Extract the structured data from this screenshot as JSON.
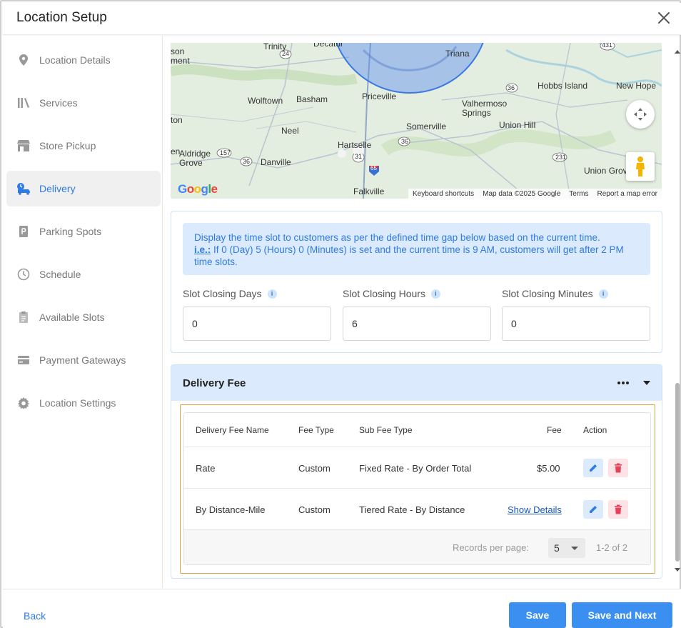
{
  "window": {
    "title": "Location Setup"
  },
  "sidebar": {
    "items": [
      {
        "label": "Location Details",
        "icon": "map-pin-icon"
      },
      {
        "label": "Services",
        "icon": "services-icon"
      },
      {
        "label": "Store Pickup",
        "icon": "store-icon"
      },
      {
        "label": "Delivery",
        "icon": "delivery-truck-icon",
        "active": true
      },
      {
        "label": "Parking Spots",
        "icon": "parking-icon"
      },
      {
        "label": "Schedule",
        "icon": "clock-icon"
      },
      {
        "label": "Available Slots",
        "icon": "clipboard-icon"
      },
      {
        "label": "Payment Gateways",
        "icon": "card-icon"
      },
      {
        "label": "Location Settings",
        "icon": "gear-icon"
      }
    ]
  },
  "map": {
    "places": [
      "Trinity",
      "Decatur",
      "Triana",
      "Hobbs Island",
      "New Hope",
      "Wolftown",
      "Basham",
      "Priceville",
      "Valhermoso Springs",
      "Somerville",
      "Union Hill",
      "Neel",
      "Hartselle",
      "Aldridge Grove",
      "Danville",
      "Union Grove",
      "Falkville",
      "son ment",
      "ton",
      "en"
    ],
    "roads": [
      "24",
      "431",
      "36",
      "157",
      "36",
      "31",
      "36",
      "231",
      "65"
    ],
    "footer": {
      "shortcuts": "Keyboard shortcuts",
      "data": "Map data ©2025 Google",
      "terms": "Terms",
      "report": "Report a map error"
    },
    "logo": "Google"
  },
  "slots": {
    "info_line1": "Display the time slot to customers as per the defined time gap below based on the current time.",
    "info_ie": "i.e.:",
    "info_line2": " If 0 (Day) 5 (Hours) 0 (Minutes) is set and the current time is 9 AM, customers will get after 2 PM time slots.",
    "days_label": "Slot Closing Days",
    "hours_label": "Slot Closing Hours",
    "minutes_label": "Slot Closing Minutes",
    "days_value": "0",
    "hours_value": "6",
    "minutes_value": "0",
    "info_glyph": "i"
  },
  "delivery_fee": {
    "title": "Delivery Fee",
    "columns": {
      "name": "Delivery Fee Name",
      "fee_type": "Fee Type",
      "sub_fee_type": "Sub Fee Type",
      "fee": "Fee",
      "action": "Action"
    },
    "rows": [
      {
        "name": "Rate",
        "fee_type": "Custom",
        "sub_fee_type": "Fixed Rate - By Order Total",
        "fee": "$5.00"
      },
      {
        "name": "By Distance-Mile",
        "fee_type": "Custom",
        "sub_fee_type": "Tiered Rate - By Distance",
        "fee": "Show Details"
      }
    ],
    "pager": {
      "label": "Records per page:",
      "per_page": "5",
      "range": "1-2 of 2"
    }
  },
  "footer": {
    "back": "Back",
    "save": "Save",
    "save_next": "Save and Next"
  },
  "colors": {
    "accent": "#2f7be5",
    "button": "#3b8ff0",
    "info_bg": "#dbeafd",
    "delete": "#e5415a"
  }
}
